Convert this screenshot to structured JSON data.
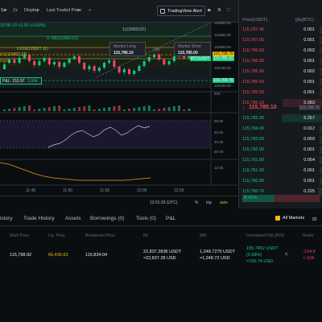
{
  "toolbar": {
    "interval": "1s",
    "display": "Display",
    "price_source": "Last Traded Price",
    "tv_alert": "TradingView Alert"
  },
  "chart": {
    "ohlc_text": "15785.10 +3.30 (+0.00%)",
    "fib_labels": [
      "1(115903.87)",
      "0.786(115860.91)",
      "0.618(115827.11)",
      "0.5(115803.37)",
      "9.62)"
    ],
    "market_long": {
      "label": "Market Long",
      "price": "115,786.10"
    },
    "qty": "Qty",
    "market_short": {
      "label": "Market Short",
      "price": "115,785.00"
    },
    "position_tag": {
      "pnl": "153.97",
      "qty": "3.904"
    },
    "btc_tag": "BTCUSDT",
    "price_tags": [
      "115,798.70",
      "115,785.10",
      "115,706.70"
    ],
    "y_ticks": [
      "115900.00",
      "115850.00",
      "115800.00",
      "115750.00",
      "115700.00",
      "200",
      "80.00",
      "60.00",
      "40.00",
      "20.00",
      "12:05"
    ],
    "x_ticks": [
      "11:45",
      "11:50",
      "11:55",
      "12:00",
      "12:05"
    ],
    "timestamp": "12:01:33 (UTC)",
    "pct": "%",
    "log": "log",
    "auto": "auto",
    "colors": {
      "up": "#0ecb81",
      "down": "#f6465d",
      "accent": "#f0b90b"
    }
  },
  "orderbook": {
    "headers": {
      "price": "Price(USDT)",
      "qty": "Qty(BTC)"
    },
    "asks": [
      {
        "price": "115,787.40",
        "qty": "0.001"
      },
      {
        "price": "115,787.00",
        "qty": "0.001"
      },
      {
        "price": "115,786.60",
        "qty": "0.002"
      },
      {
        "price": "115,786.20",
        "qty": "0.001"
      },
      {
        "price": "115,785.90",
        "qty": "0.002"
      },
      {
        "price": "115,785.60",
        "qty": "0.001"
      },
      {
        "price": "115,785.50",
        "qty": "0.001"
      },
      {
        "price": "115,785.10",
        "qty": "5.083"
      }
    ],
    "mid": {
      "price": "115,785.10",
      "mark": "115,798.70"
    },
    "bids": [
      {
        "price": "115,785.00",
        "qty": "5.257"
      },
      {
        "price": "115,784.00",
        "qty": "0.012"
      },
      {
        "price": "115,783.00",
        "qty": "0.003"
      },
      {
        "price": "115,782.00",
        "qty": "0.001"
      },
      {
        "price": "115,781.00",
        "qty": "0.054"
      },
      {
        "price": "115,781.00",
        "qty": "0.001"
      },
      {
        "price": "115,780.90",
        "qty": "0.001"
      },
      {
        "price": "115,780.70",
        "qty": "0.225"
      }
    ],
    "ratio": "41%"
  },
  "panel": {
    "tabs": [
      "istory",
      "Trade History",
      "Assets",
      "Borrowings (0)",
      "Tools (0)",
      "P&L"
    ],
    "all_markets": "All Markets",
    "columns": [
      "Mark Price",
      "Liq. Price",
      "Breakeven Price",
      "IM",
      "MM",
      "Unrealized P&L(ROI)",
      "Realiz"
    ],
    "position": {
      "mark_price": "115,798.92",
      "liq_price": "66,436.63",
      "breakeven": "115,834.04",
      "im_1": "22,837.2836 USDT",
      "im_2": "≈22,837.28 USD",
      "mm_1": "1,248.7275 USDT",
      "mm_2": "≈1,248.72 USD",
      "upnl_1": "155.7452 USDT",
      "upnl_2": "(0.68%)",
      "upnl_3": "≈155.74 USD",
      "realized_1": "-124.9",
      "realized_2": "≈-124"
    }
  }
}
